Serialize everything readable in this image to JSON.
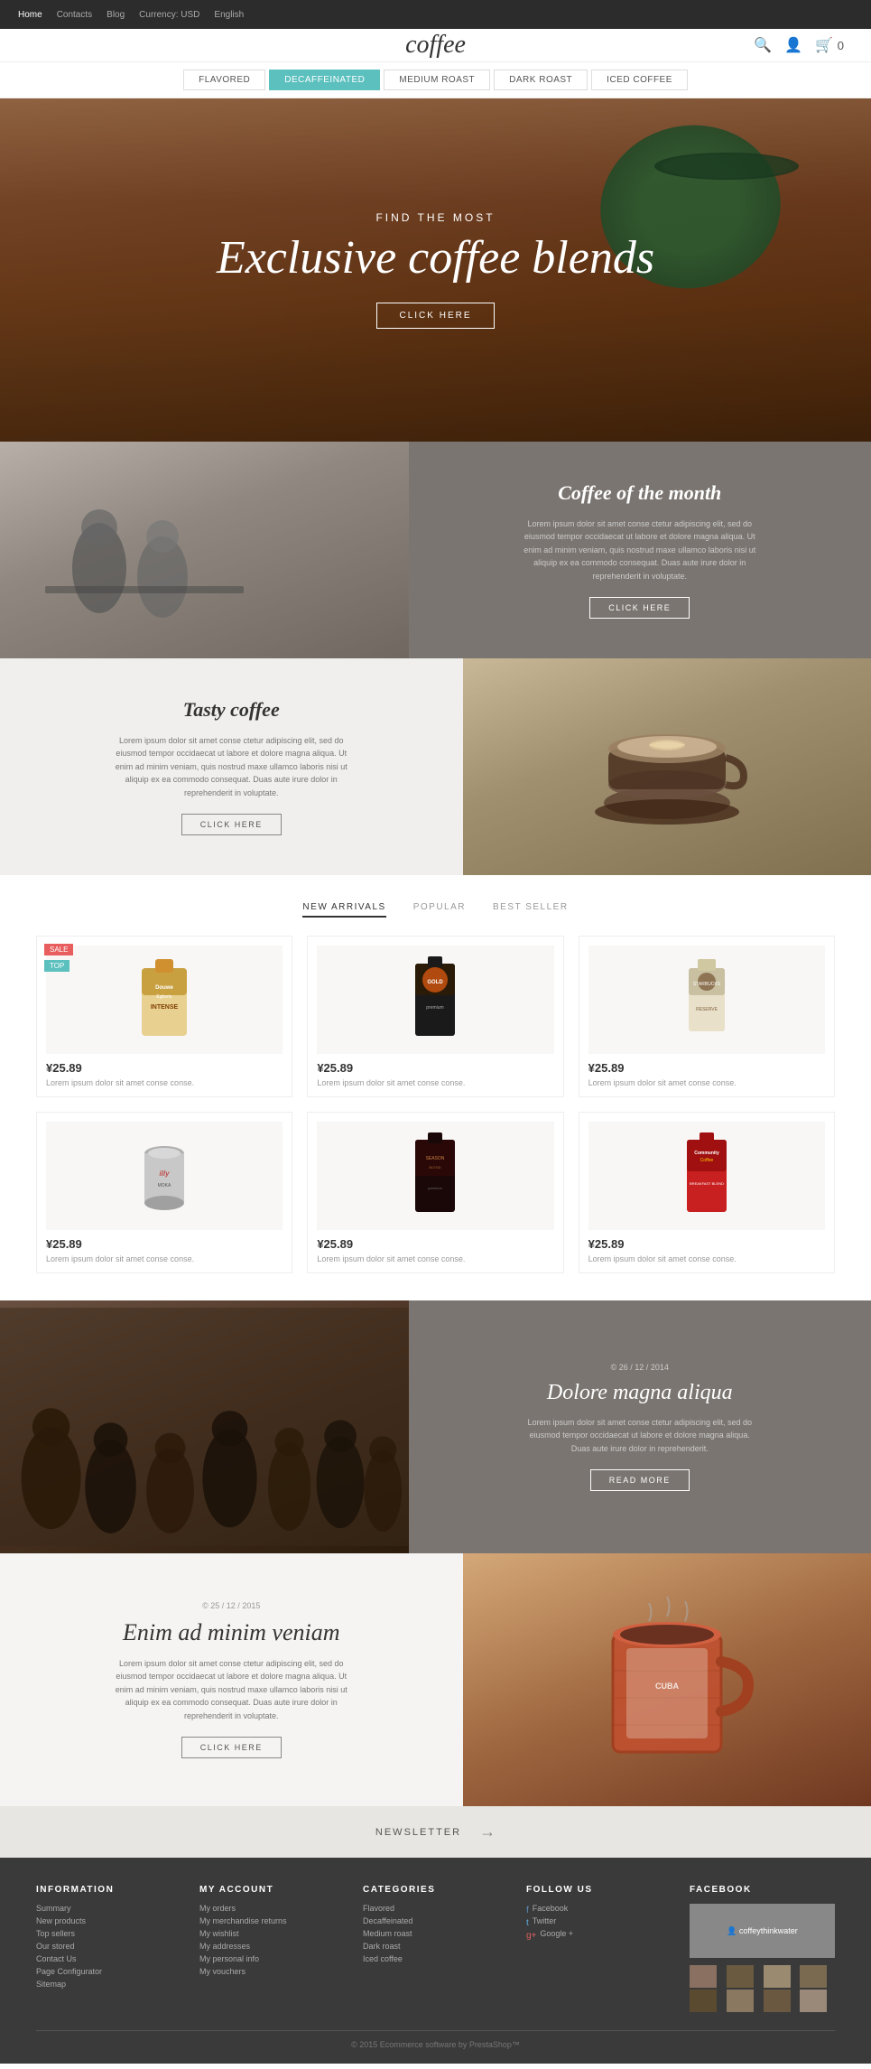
{
  "topnav": {
    "links": [
      "Home",
      "Contacts",
      "Blog",
      "Currency: USD",
      "English"
    ],
    "active": "Home"
  },
  "header": {
    "logo": "coffee",
    "icons": [
      "search",
      "user",
      "cart"
    ],
    "cart_count": "0"
  },
  "category_nav": {
    "items": [
      "FLAVORED",
      "DECAFFEINATED",
      "MEDIUM ROAST",
      "DARK ROAST",
      "ICED COFFEE"
    ],
    "active": "DECAFFEINATED"
  },
  "hero": {
    "subtitle": "FIND THE MOST",
    "title": "Exclusive coffee blends",
    "button": "CLICK HERE"
  },
  "section_month": {
    "title": "Coffee of the month",
    "desc": "Lorem ipsum dolor sit amet conse ctetur adipiscing elit, sed do eiusmod tempor occidaecat ut labore et dolore magna aliqua. Ut enim ad minim veniam, quis nostrud maxe ullamco laboris nisi ut aliquip ex ea commodo consequat. Duas aute irure dolor in reprehenderit in voluptate.",
    "button": "CLICK HERE"
  },
  "section_tasty": {
    "title": "Tasty coffee",
    "desc": "Lorem ipsum dolor sit amet conse ctetur adipiscing elit, sed do eiusmod tempor occidaecat ut labore et dolore magna aliqua. Ut enim ad minim veniam, quis nostrud maxe ullamco laboris nisi ut aliquip ex ea commodo consequat. Duas aute irure dolor in reprehenderit in voluptate.",
    "button": "CLICK HERE"
  },
  "products": {
    "tabs": [
      "NEW ARRIVALS",
      "POPULAR",
      "BEST SELLER"
    ],
    "active_tab": "NEW ARRIVALS",
    "items": [
      {
        "name": "Lorem ipsum dolor sit amet conse conse.",
        "price": "¥25.89",
        "badges": [
          "SALE",
          "TOP"
        ]
      },
      {
        "name": "Lorem ipsum dolor sit amet conse conse.",
        "price": "¥25.89",
        "badges": []
      },
      {
        "name": "Lorem ipsum dolor sit amet conse conse.",
        "price": "¥25.89",
        "badges": []
      },
      {
        "name": "Lorem ipsum dolor sit amet conse conse.",
        "price": "¥25.89",
        "badges": []
      },
      {
        "name": "Lorem ipsum dolor sit amet conse conse.",
        "price": "¥25.89",
        "badges": []
      },
      {
        "name": "Lorem ipsum dolor sit amet conse conse.",
        "price": "¥25.89",
        "badges": []
      }
    ]
  },
  "blog1": {
    "date": "© 26 / 12 / 2014",
    "title": "Dolore magna aliqua",
    "desc": "Lorem ipsum dolor sit amet conse ctetur adipiscing elit, sed do eiusmod tempor occidaecat ut labore et dolore magna aliqua. Duas aute irure dolor in reprehenderit.",
    "button": "READ MORE"
  },
  "blog2": {
    "date": "© 25 / 12 / 2015",
    "title": "Enim ad minim veniam",
    "desc": "Lorem ipsum dolor sit amet conse ctetur adipiscing elit, sed do eiusmod tempor occidaecat ut labore et dolore magna aliqua. Ut enim ad minim veniam, quis nostrud maxe ullamco laboris nisi ut aliquip ex ea commodo consequat. Duas aute irure dolor in reprehenderit in voluptate.",
    "button": "CLICK HERE"
  },
  "newsletter": {
    "label": "NEWSLETTER"
  },
  "footer": {
    "columns": [
      {
        "title": "INFORMATION",
        "links": [
          "Summary",
          "New products",
          "Top sellers",
          "Our stored",
          "Contact Us",
          "Page Configurator",
          "Sitemap"
        ]
      },
      {
        "title": "MY ACCOUNT",
        "links": [
          "My orders",
          "My merchandise returns",
          "My wishlist",
          "My addresses",
          "My personal info",
          "My vouchers"
        ]
      },
      {
        "title": "CATEGORIES",
        "links": [
          "Flavored",
          "Decaffeinated",
          "Medium roast",
          "Dark roast",
          "Iced coffee"
        ]
      },
      {
        "title": "FOLLOW US",
        "links": [
          "Facebook",
          "Twitter",
          "Google +"
        ]
      },
      {
        "title": "FACEBOOK",
        "thumbs": 8
      }
    ],
    "copyright": "© 2015 Ecommerce software by PrestaShop™"
  }
}
